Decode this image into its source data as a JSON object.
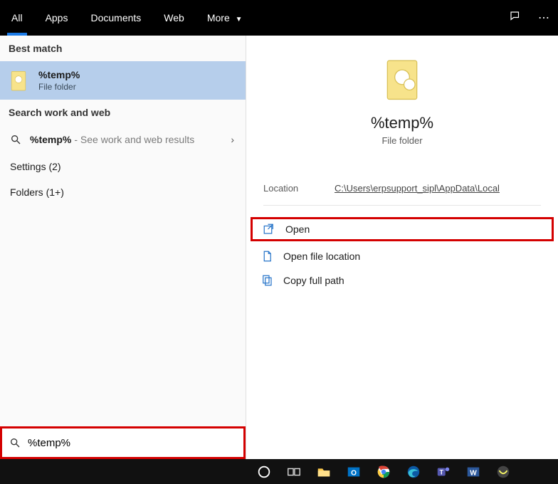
{
  "tabs": {
    "all": "All",
    "apps": "Apps",
    "documents": "Documents",
    "web": "Web",
    "more": "More"
  },
  "left": {
    "best_label": "Best match",
    "best_title": "%temp%",
    "best_sub": "File folder",
    "search_section": "Search work and web",
    "web_query": "%temp%",
    "web_hint": "- See work and web results",
    "settings": "Settings (2)",
    "folders": "Folders (1+)"
  },
  "right": {
    "title": "%temp%",
    "sub": "File folder",
    "location_label": "Location",
    "location_value": "C:\\Users\\erpsupport_sipl\\AppData\\Local",
    "actions": {
      "open": "Open",
      "open_loc": "Open file location",
      "copy_path": "Copy full path"
    }
  },
  "search_value": "%temp%",
  "taskbar_items": [
    "cortana",
    "taskview",
    "explorer",
    "outlook",
    "chrome",
    "edge",
    "teams",
    "word",
    "snip"
  ]
}
